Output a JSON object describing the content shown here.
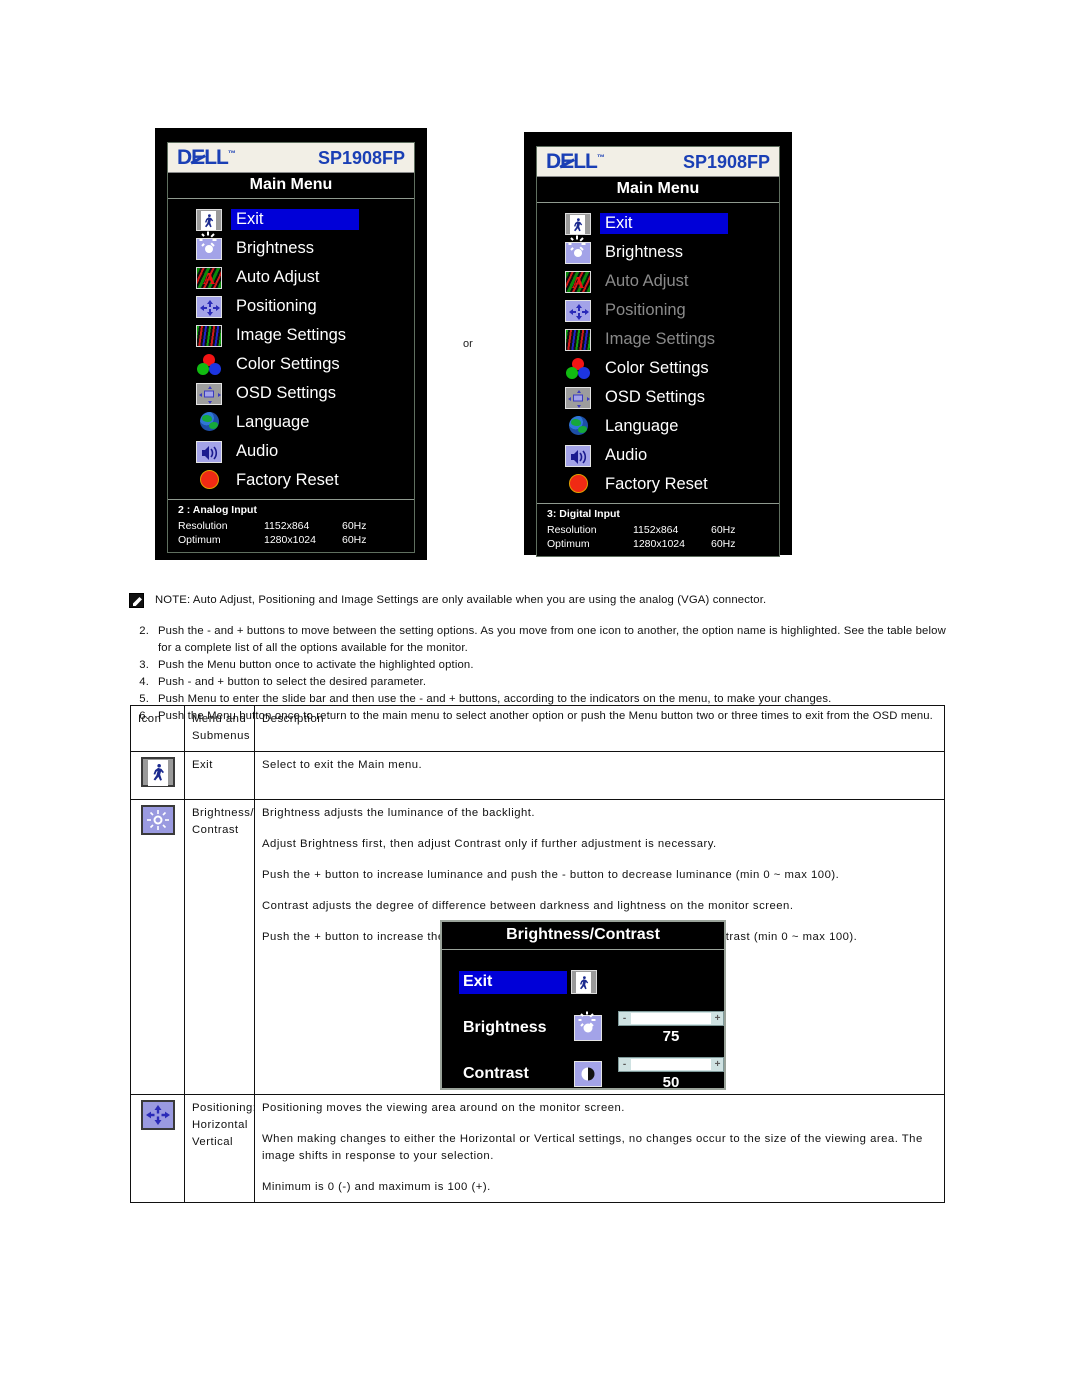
{
  "osd_analog": {
    "brand": "DELL",
    "trademark": "™",
    "model": "SP1908FP",
    "title": "Main Menu",
    "items": [
      {
        "label": "Exit",
        "icon": "exit-icon",
        "state": "selected"
      },
      {
        "label": "Brightness",
        "icon": "brightness-icon",
        "state": "normal"
      },
      {
        "label": "Auto Adjust",
        "icon": "auto-adjust-icon",
        "state": "normal"
      },
      {
        "label": "Positioning",
        "icon": "positioning-icon",
        "state": "normal"
      },
      {
        "label": "Image Settings",
        "icon": "image-settings-icon",
        "state": "normal"
      },
      {
        "label": "Color Settings",
        "icon": "color-settings-icon",
        "state": "normal"
      },
      {
        "label": "OSD Settings",
        "icon": "osd-settings-icon",
        "state": "normal"
      },
      {
        "label": "Language",
        "icon": "language-icon",
        "state": "normal"
      },
      {
        "label": "Audio",
        "icon": "audio-icon",
        "state": "normal"
      },
      {
        "label": "Factory Reset",
        "icon": "factory-reset-icon",
        "state": "normal"
      }
    ],
    "footer": {
      "input": "2 : Analog Input",
      "resolution_label": "Resolution",
      "resolution_value": "1152x864",
      "resolution_rate": "60Hz",
      "optimum_label": "Optimum",
      "optimum_value": "1280x1024",
      "optimum_rate": "60Hz"
    }
  },
  "osd_digital": {
    "brand": "DELL",
    "trademark": "™",
    "model": "SP1908FP",
    "title": "Main Menu",
    "items": [
      {
        "label": "Exit",
        "icon": "exit-icon",
        "state": "selected"
      },
      {
        "label": "Brightness",
        "icon": "brightness-icon",
        "state": "normal"
      },
      {
        "label": "Auto Adjust",
        "icon": "auto-adjust-icon",
        "state": "disabled"
      },
      {
        "label": "Positioning",
        "icon": "positioning-icon",
        "state": "disabled"
      },
      {
        "label": "Image Settings",
        "icon": "image-settings-icon",
        "state": "disabled"
      },
      {
        "label": "Color Settings",
        "icon": "color-settings-icon",
        "state": "normal"
      },
      {
        "label": "OSD Settings",
        "icon": "osd-settings-icon",
        "state": "normal"
      },
      {
        "label": "Language",
        "icon": "language-icon",
        "state": "normal"
      },
      {
        "label": "Audio",
        "icon": "audio-icon",
        "state": "normal"
      },
      {
        "label": "Factory Reset",
        "icon": "factory-reset-icon",
        "state": "normal"
      }
    ],
    "footer": {
      "input": "3: Digital Input",
      "resolution_label": "Resolution",
      "resolution_value": "1152x864",
      "resolution_rate": "60Hz",
      "optimum_label": "Optimum",
      "optimum_value": "1280x1024",
      "optimum_rate": "60Hz"
    }
  },
  "separator_text": "or",
  "note": {
    "text": "NOTE: Auto Adjust, Positioning and Image Settings are only available when you are using the analog (VGA) connector."
  },
  "steps": [
    {
      "num": "2.",
      "text": "Push the - and + buttons to move between the setting options. As you move from one icon to another, the option name is highlighted. See the table below for a complete list of all the options available for the monitor."
    },
    {
      "num": "3.",
      "text": "Push the Menu button once to activate the highlighted option."
    },
    {
      "num": "4.",
      "text": "Push - and + button to select the desired parameter."
    },
    {
      "num": "5.",
      "text": "Push Menu to enter the slide bar and then use the - and + buttons, according to the indicators on the menu, to make your changes."
    },
    {
      "num": "6.",
      "text": "Push the Menu button once to return to the main menu to select another option or push the Menu button two or three times to exit from the OSD menu."
    }
  ],
  "table": {
    "headers": {
      "icon": "Icon",
      "menu": "Menu and Submenus",
      "description": "Description"
    },
    "rows": [
      {
        "icon": "exit-icon",
        "menu": "Exit",
        "paragraphs": [
          "Select to exit the Main menu."
        ]
      },
      {
        "icon": "brightness-icon",
        "menu": "Brightness/ Contrast",
        "paragraphs": [
          "Brightness adjusts the luminance of the backlight.",
          "Adjust Brightness first, then adjust Contrast only if further adjustment is necessary.",
          "Push the + button to increase luminance and push the - button to decrease luminance (min 0 ~ max 100).",
          "Contrast adjusts the degree of difference between darkness and lightness on the monitor screen.",
          "Push the + button to increase the contrast and push the - button to decrease the contrast (min 0 ~ max 100)."
        ]
      },
      {
        "icon": "positioning-icon",
        "menu": "Positioning: Horizontal Vertical",
        "paragraphs": [
          "Positioning moves the viewing area around on the monitor screen.",
          "When making changes to either the Horizontal or Vertical settings, no changes occur to the size of the viewing area. The image shifts in response to your selection.",
          "Minimum is 0 (-) and maximum is 100 (+)."
        ]
      }
    ]
  },
  "bc_osd": {
    "title": "Brightness/Contrast",
    "exit_label": "Exit",
    "brightness_label": "Brightness",
    "brightness_value": "75",
    "brightness_percent": 75,
    "contrast_label": "Contrast",
    "contrast_value": "50",
    "contrast_percent": 50,
    "minus": "-",
    "plus": "+"
  }
}
